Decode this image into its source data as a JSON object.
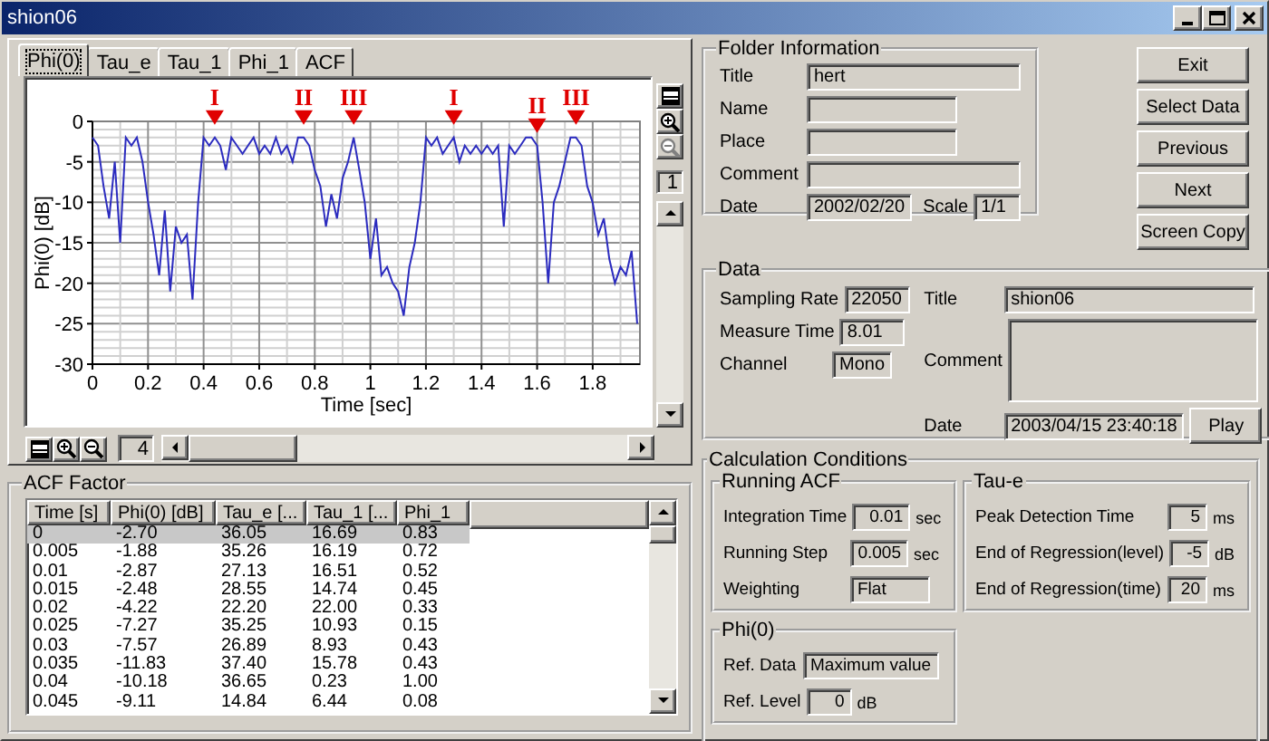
{
  "window": {
    "title": "shion06"
  },
  "tabs": [
    {
      "label": "Phi(0)",
      "selected": true
    },
    {
      "label": "Tau_e",
      "selected": false
    },
    {
      "label": "Tau_1",
      "selected": false
    },
    {
      "label": "Phi_1",
      "selected": false
    },
    {
      "label": "ACF",
      "selected": false
    }
  ],
  "chart": {
    "vertical_zoom": "1",
    "horizontal_zoom": "4",
    "chart_data": {
      "type": "line",
      "xlabel": "Time [sec]",
      "ylabel": "Phi(0) [dB]",
      "xlim": [
        0,
        1.97
      ],
      "ylim": [
        -30,
        0
      ],
      "xticks": [
        0,
        0.2,
        0.4,
        0.6,
        0.8,
        1,
        1.2,
        1.4,
        1.6,
        1.8
      ],
      "yticks": [
        0,
        -5,
        -10,
        -15,
        -20,
        -25,
        -30
      ],
      "x": [
        0,
        0.02,
        0.04,
        0.06,
        0.08,
        0.1,
        0.12,
        0.14,
        0.16,
        0.18,
        0.2,
        0.22,
        0.24,
        0.26,
        0.28,
        0.3,
        0.32,
        0.34,
        0.36,
        0.38,
        0.4,
        0.42,
        0.44,
        0.46,
        0.48,
        0.5,
        0.52,
        0.54,
        0.56,
        0.58,
        0.6,
        0.62,
        0.64,
        0.66,
        0.68,
        0.7,
        0.72,
        0.74,
        0.76,
        0.78,
        0.8,
        0.82,
        0.84,
        0.86,
        0.88,
        0.9,
        0.92,
        0.94,
        0.96,
        0.98,
        1,
        1.02,
        1.04,
        1.06,
        1.08,
        1.1,
        1.12,
        1.14,
        1.16,
        1.18,
        1.2,
        1.22,
        1.24,
        1.26,
        1.28,
        1.3,
        1.32,
        1.34,
        1.36,
        1.38,
        1.4,
        1.42,
        1.44,
        1.46,
        1.48,
        1.5,
        1.52,
        1.54,
        1.56,
        1.58,
        1.6,
        1.62,
        1.64,
        1.66,
        1.68,
        1.7,
        1.72,
        1.74,
        1.76,
        1.78,
        1.8,
        1.82,
        1.84,
        1.86,
        1.88,
        1.9,
        1.92,
        1.94,
        1.96
      ],
      "grid": true,
      "series": [
        {
          "color": "#2b2bbf",
          "values": [
            -2,
            -3,
            -8,
            -12,
            -5,
            -15,
            -2,
            -3,
            -2,
            -5,
            -10,
            -14,
            -19,
            -11,
            -21,
            -13,
            -15,
            -14,
            -22,
            -10,
            -2,
            -3,
            -2,
            -3,
            -6,
            -2,
            -3,
            -4,
            -3,
            -2,
            -4,
            -3,
            -4,
            -2,
            -4,
            -3,
            -5,
            -2,
            -2,
            -3,
            -6,
            -8,
            -13,
            -9,
            -12,
            -7,
            -5,
            -2,
            -6,
            -10,
            -17,
            -12,
            -19,
            -18,
            -20,
            -21,
            -24,
            -18,
            -15,
            -10,
            -2,
            -3,
            -2,
            -4,
            -3,
            -2,
            -5,
            -3,
            -4,
            -3,
            -4,
            -3,
            -4,
            -3,
            -13,
            -3,
            -4,
            -3,
            -2,
            -2,
            -3,
            -10,
            -20,
            -10,
            -8,
            -5,
            -2,
            -2,
            -3,
            -8,
            -10,
            -14,
            -12,
            -17,
            -20,
            -18,
            -19,
            -16,
            -25
          ]
        }
      ],
      "annotations": [
        {
          "x": 0.44,
          "y": -2,
          "text": "I"
        },
        {
          "x": 0.76,
          "y": -2,
          "text": "II"
        },
        {
          "x": 0.94,
          "y": -2,
          "text": "III"
        },
        {
          "x": 1.3,
          "y": -2,
          "text": "I"
        },
        {
          "x": 1.6,
          "y": -3,
          "text": "II"
        },
        {
          "x": 1.74,
          "y": -2,
          "text": "III"
        }
      ]
    }
  },
  "acf_factor": {
    "title": "ACF Factor",
    "columns": [
      "Time [s]",
      "Phi(0) [dB]",
      "Tau_e [...",
      "Tau_1 [...",
      "Phi_1"
    ],
    "rows": [
      {
        "cells": [
          "0",
          "-2.70",
          "36.05",
          "16.69",
          "0.83"
        ],
        "selected": true
      },
      {
        "cells": [
          "0.005",
          "-1.88",
          "35.26",
          "16.19",
          "0.72"
        ],
        "selected": false
      },
      {
        "cells": [
          "0.01",
          "-2.87",
          "27.13",
          "16.51",
          "0.52"
        ],
        "selected": false
      },
      {
        "cells": [
          "0.015",
          "-2.48",
          "28.55",
          "14.74",
          "0.45"
        ],
        "selected": false
      },
      {
        "cells": [
          "0.02",
          "-4.22",
          "22.20",
          "22.00",
          "0.33"
        ],
        "selected": false
      },
      {
        "cells": [
          "0.025",
          "-7.27",
          "35.25",
          "10.93",
          "0.15"
        ],
        "selected": false
      },
      {
        "cells": [
          "0.03",
          "-7.57",
          "26.89",
          "8.93",
          "0.43"
        ],
        "selected": false
      },
      {
        "cells": [
          "0.035",
          "-11.83",
          "37.40",
          "15.78",
          "0.43"
        ],
        "selected": false
      },
      {
        "cells": [
          "0.04",
          "-10.18",
          "36.65",
          "0.23",
          "1.00"
        ],
        "selected": false
      },
      {
        "cells": [
          "0.045",
          "-9.11",
          "14.84",
          "6.44",
          "0.08"
        ],
        "selected": false
      }
    ]
  },
  "folder_information": {
    "title": "Folder Information",
    "fields": [
      {
        "label": "Title",
        "value": "hert"
      },
      {
        "label": "Name"
      },
      {
        "label": "Place"
      },
      {
        "label": "Comment"
      },
      {
        "label": "Date",
        "value": "2002/02/20"
      },
      {
        "label": "Scale",
        "value": "1/1"
      }
    ]
  },
  "buttons": [
    "Exit",
    "Select Data",
    "Previous",
    "Next",
    "Screen Copy"
  ],
  "data": {
    "title": "Data",
    "fields": [
      {
        "label": "Sampling Rate",
        "value": "22050"
      },
      {
        "label": "Measure Time",
        "value": "8.01"
      },
      {
        "label": "Channel",
        "value": "Mono"
      },
      {
        "label": "Title",
        "value": "shion06"
      },
      {
        "label": "Comment"
      },
      {
        "label": "Date",
        "value": "2003/04/15 23:40:18"
      }
    ],
    "play_button": "Play"
  },
  "calculation_conditions": {
    "title": "Calculation Conditions",
    "groups": [
      {
        "title": "Running ACF",
        "fields": [
          {
            "label": "Integration Time",
            "value": "0.01",
            "unit": "sec",
            "kind": "number"
          },
          {
            "label": "Running Step",
            "value": "0.005",
            "unit": "sec",
            "kind": "number"
          },
          {
            "label": "Weighting",
            "value": "Flat",
            "kind": "text"
          }
        ]
      },
      {
        "title": "Tau-e",
        "fields": [
          {
            "label": "Peak Detection Time",
            "value": "5",
            "unit": "ms",
            "kind": "number"
          },
          {
            "label": "End of Regression(level)",
            "value": "-5",
            "unit": "dB",
            "kind": "number"
          },
          {
            "label": "End of Regression(time)",
            "value": "20",
            "unit": "ms",
            "kind": "number"
          }
        ]
      },
      {
        "title": "Phi(0)",
        "fields": [
          {
            "label": "Ref. Data",
            "value": "Maximum value",
            "kind": "text"
          },
          {
            "label": "Ref. Level",
            "value": "0",
            "unit": "dB",
            "kind": "number"
          }
        ]
      }
    ]
  }
}
